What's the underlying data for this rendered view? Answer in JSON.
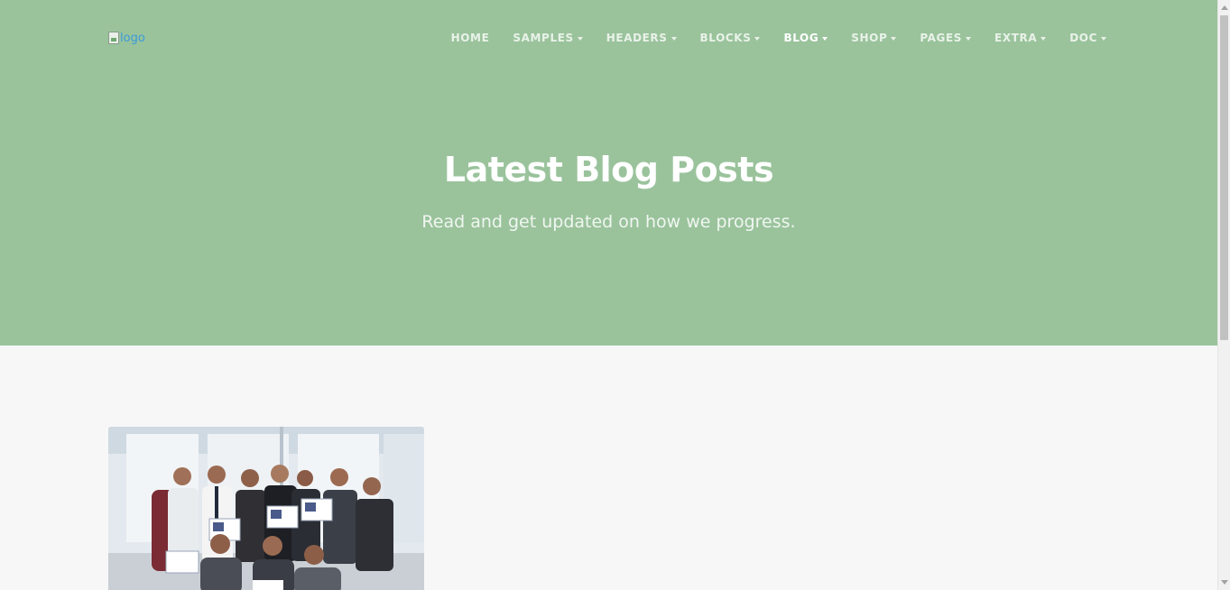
{
  "header": {
    "logo_alt": "logo",
    "nav": [
      {
        "label": "HOME",
        "dropdown": false,
        "active": false
      },
      {
        "label": "SAMPLES",
        "dropdown": true,
        "active": false
      },
      {
        "label": "HEADERS",
        "dropdown": true,
        "active": false
      },
      {
        "label": "BLOCKS",
        "dropdown": true,
        "active": false
      },
      {
        "label": "BLOG",
        "dropdown": true,
        "active": true
      },
      {
        "label": "SHOP",
        "dropdown": true,
        "active": false
      },
      {
        "label": "PAGES",
        "dropdown": true,
        "active": false
      },
      {
        "label": "EXTRA",
        "dropdown": true,
        "active": false
      },
      {
        "label": "DOC",
        "dropdown": true,
        "active": false
      }
    ]
  },
  "hero": {
    "title": "Latest Blog Posts",
    "subtitle": "Read and get updated on how we progress."
  },
  "colors": {
    "hero_background": "#9ac39c",
    "page_background": "#f7f7f7",
    "nav_text": "#ffffff",
    "logo_link": "#3a9bd8"
  },
  "icons": {
    "broken_image": "broken-image-icon",
    "dropdown_caret": "caret-down-icon"
  }
}
